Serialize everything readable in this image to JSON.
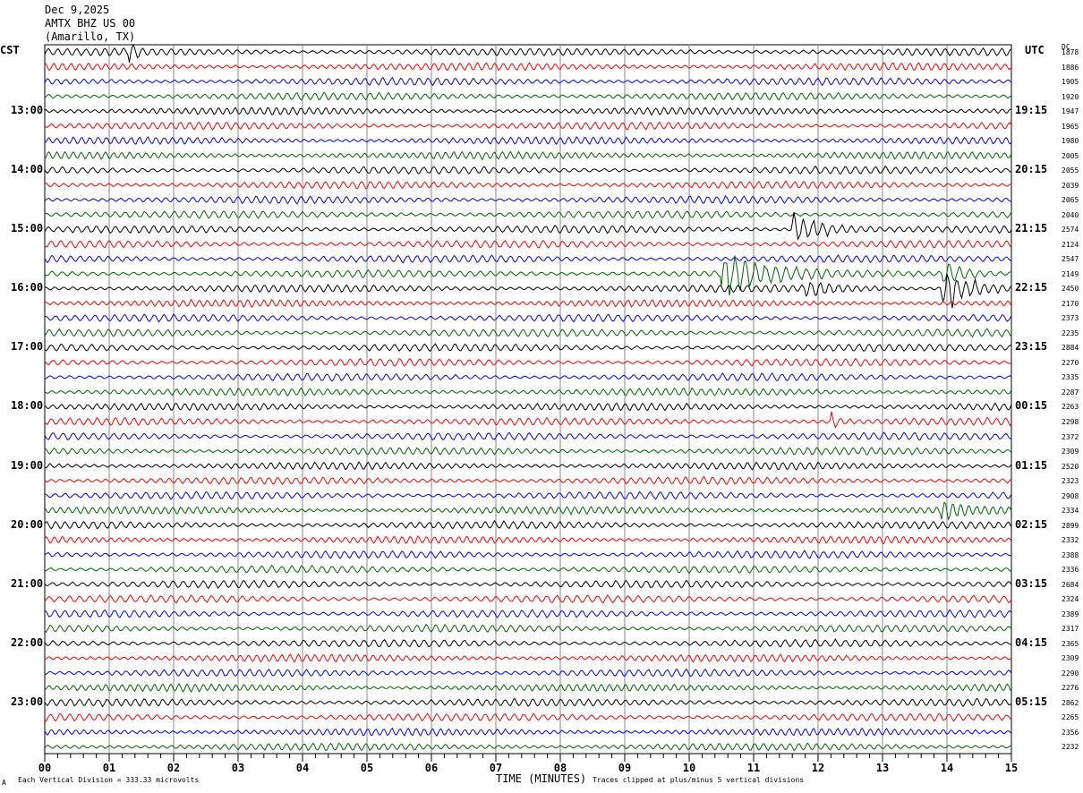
{
  "header": {
    "date": "Dec 9,2025",
    "station": "AMTX BHZ US 00",
    "location": "(Amarillo, TX)"
  },
  "left_timezone": "CST",
  "right_timezone": "UTC",
  "dc_label": "DC",
  "footer": {
    "scale": "Each Vertical Division =  333.33 microvolts",
    "xlabel": "TIME (MINUTES)",
    "clip_note": "Traces clipped at plus/minus 5 vertical divisions",
    "corner_mark": "A"
  },
  "chart_data": {
    "type": "line",
    "xlabel": "TIME (MINUTES)",
    "xlim": [
      0,
      15
    ],
    "x_ticks": [
      "00",
      "01",
      "02",
      "03",
      "04",
      "05",
      "06",
      "07",
      "08",
      "09",
      "10",
      "11",
      "12",
      "13",
      "14",
      "15"
    ],
    "grid": true,
    "trace_colors": [
      "#000000",
      "#ff0000",
      "#0000ff",
      "#006400"
    ],
    "left_labels": [
      "13:00",
      "14:00",
      "15:00",
      "16:00",
      "17:00",
      "18:00",
      "19:00",
      "20:00",
      "21:00",
      "22:00",
      "23:00"
    ],
    "right_labels": [
      "19:15",
      "20:15",
      "21:15",
      "22:15",
      "23:15",
      "00:15",
      "01:15",
      "02:15",
      "03:15",
      "04:15",
      "05:15"
    ],
    "trace_count": 48,
    "dc_values": [
      "1878",
      "1886",
      "1905",
      "1920",
      "1947",
      "1965",
      "1980",
      "2005",
      "2055",
      "2039",
      "2065",
      "2040",
      "2574",
      "2124",
      "2547",
      "2149",
      "2450",
      "2170",
      "2373",
      "2235",
      "2884",
      "2270",
      "2335",
      "2287",
      "2263",
      "2298",
      "2372",
      "2309",
      "2520",
      "2323",
      "2908",
      "2334",
      "2899",
      "2332",
      "2388",
      "2336",
      "2684",
      "2324",
      "2389",
      "2317",
      "2365",
      "2309",
      "2290",
      "2276",
      "2862",
      "2265",
      "2356",
      "2232"
    ],
    "events": [
      {
        "trace": 0,
        "start": 1.3,
        "end": 1.6,
        "amplitude": 2
      },
      {
        "trace": 12,
        "start": 11.6,
        "end": 13.0,
        "amplitude": 2.5
      },
      {
        "trace": 15,
        "start": 10.5,
        "end": 12.2,
        "amplitude": 4
      },
      {
        "trace": 15,
        "start": 13.9,
        "end": 15,
        "amplitude": 2
      },
      {
        "trace": 16,
        "start": 11.8,
        "end": 13.0,
        "amplitude": 1.2
      },
      {
        "trace": 16,
        "start": 13.9,
        "end": 15,
        "amplitude": 5
      },
      {
        "trace": 25,
        "start": 12.2,
        "end": 12.5,
        "amplitude": 1.5
      },
      {
        "trace": 31,
        "start": 13.9,
        "end": 15,
        "amplitude": 1.3
      }
    ]
  }
}
